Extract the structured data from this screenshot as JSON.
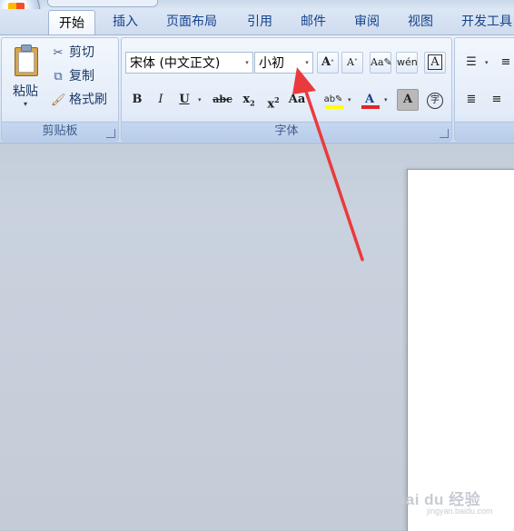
{
  "tabs": [
    "开始",
    "插入",
    "页面布局",
    "引用",
    "邮件",
    "审阅",
    "视图",
    "开发工具"
  ],
  "clipboard": {
    "group_title": "剪贴板",
    "paste_label": "粘贴",
    "cut_label": "剪切",
    "copy_label": "复制",
    "format_painter_label": "格式刷"
  },
  "font": {
    "group_title": "字体",
    "font_name": "宋体 (中文正文)",
    "font_size": "小初"
  },
  "watermark": {
    "text": "Bai du 经验",
    "sub": "jingyan.baidu.com"
  },
  "colors": {
    "highlight": "#ffff00",
    "font_color": "#e0262b",
    "annotation_arrow": "#ea3a3d"
  }
}
